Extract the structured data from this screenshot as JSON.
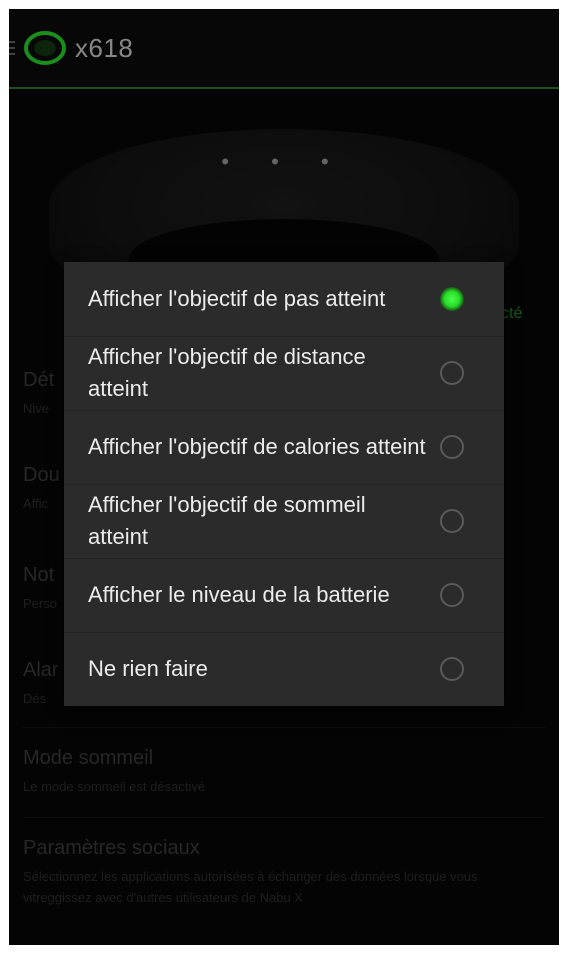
{
  "app": {
    "title": "x618"
  },
  "header_dots": "• • •",
  "side_label": "cté",
  "settings": [
    {
      "title": "Dét",
      "subtitle": "Nive"
    },
    {
      "title": "Dou",
      "subtitle": "Affic"
    },
    {
      "title": "Not",
      "subtitle": "Perso"
    },
    {
      "title": "Alar",
      "subtitle": "Dés"
    },
    {
      "title": "Mode sommeil",
      "subtitle": "Le mode sommeil est désactivé"
    },
    {
      "title": "Paramètres sociaux",
      "subtitle": "Sélectionnez les applications autorisées à échanger des données lorsque vous vitreggissez avec d'autres utilisateurs de Nabu X"
    }
  ],
  "dialog": {
    "options": [
      {
        "label": "Afficher l'objectif de pas atteint",
        "selected": true
      },
      {
        "label": "Afficher l'objectif de distance atteint",
        "selected": false
      },
      {
        "label": "Afficher l'objectif de calories atteint",
        "selected": false
      },
      {
        "label": "Afficher l'objectif de sommeil atteint",
        "selected": false
      },
      {
        "label": "Afficher le niveau de la batterie",
        "selected": false
      },
      {
        "label": "Ne rien faire",
        "selected": false
      }
    ]
  },
  "colors": {
    "accent": "#2adb2a",
    "background": "#070707",
    "dialog": "#2b2b2b"
  }
}
